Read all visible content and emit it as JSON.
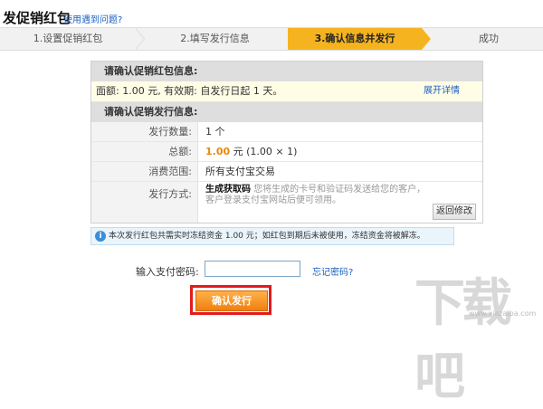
{
  "header": {
    "title": "发促销红包",
    "help_link": "使用遇到问题?"
  },
  "steps": [
    {
      "label": "1.设置促销红包",
      "active": false
    },
    {
      "label": "2.填写发行信息",
      "active": false
    },
    {
      "label": "3.确认信息并发行",
      "active": true
    },
    {
      "label": "成功",
      "active": false
    }
  ],
  "section1": {
    "heading": "请确认促销红包信息:",
    "info": "面额: 1.00 元, 有效期: 自发行日起 1 天。",
    "detail_link": "展开详情"
  },
  "section2": {
    "heading": "请确认促销发行信息:",
    "rows": [
      {
        "label": "发行数量:",
        "value": "1 个"
      },
      {
        "label": "总额:",
        "amount": "1.00",
        "value": "元 (1.00 × 1)"
      },
      {
        "label": "消费范围:",
        "value": "所有支付宝交易"
      },
      {
        "label": "发行方式:",
        "strong": "生成获取码",
        "desc": "您将生成的卡号和验证码发送给您的客户，客户登录支付宝网站后便可领用。"
      }
    ],
    "back_button": "返回修改"
  },
  "notice": "本次发行红包共需实时冻结资金 1.00 元；如红包到期后未被使用，冻结资金将被解冻。",
  "password": {
    "label": "输入支付密码:",
    "value": "",
    "forgot_link": "忘记密码?"
  },
  "confirm_button": "确认发行",
  "watermark": {
    "text": "下载吧",
    "sub": "www.xiazaiba.com"
  },
  "colors": {
    "accent": "#f5b41f",
    "link": "#1a5fc0",
    "amount": "#e8890b",
    "highlight_frame": "#e21b1b"
  }
}
